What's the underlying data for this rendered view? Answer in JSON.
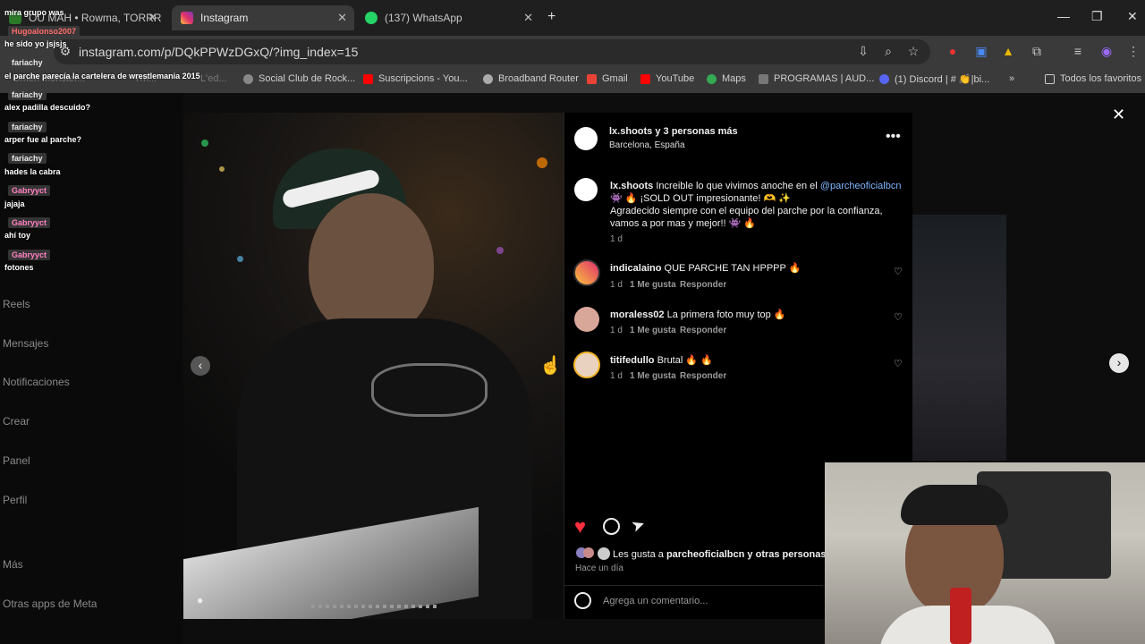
{
  "tabs": [
    {
      "label": "OU MAH • Rowma, TORRR",
      "active": false
    },
    {
      "label": "Instagram",
      "active": true
    },
    {
      "label": "(137) WhatsApp",
      "active": false
    }
  ],
  "address_bar": {
    "url": "instagram.com/p/DQkPPWzDGxQ/?img_index=15"
  },
  "bookmarks": [
    {
      "label": "Social Club de Rock...",
      "color": "#888"
    },
    {
      "label": "Suscripcions - You...",
      "color": "#ff0000"
    },
    {
      "label": "Broadband Router",
      "color": "#aaa"
    },
    {
      "label": "Gmail",
      "color": "#ea4335"
    },
    {
      "label": "YouTube",
      "color": "#ff0000"
    },
    {
      "label": "Maps",
      "color": "#34a853"
    },
    {
      "label": "PROGRAMAS | AUD...",
      "color": "#777"
    },
    {
      "label": "(1) Discord | # 👏|bi...",
      "color": "#5865f2"
    }
  ],
  "bookmarks_partial": {
    "a": "Omen Monster...",
    "b": "Tm...",
    "c": "L'ed..."
  },
  "bookmarks_folder": "Todos los favoritos",
  "sidebar_nav": [
    "Reels",
    "Mensajes",
    "Notificaciones",
    "Crear",
    "Panel",
    "Perfil",
    "Más",
    "Otras apps de Meta"
  ],
  "post": {
    "header_user": "lx.shoots y 3 personas más",
    "location": "Barcelona, España",
    "caption_user": "lx.shoots",
    "caption_line1": "Increible lo que vivimos anoche en el",
    "caption_mention": "@parcheoficialbcn",
    "caption_line2": "👾 🔥 ¡SOLD OUT impresionante! 🫶 ✨",
    "caption_line3": "Agradecido siempre con el equipo del parche por la confianza,",
    "caption_line4": "vamos a por mas y mejor!! 👾 🔥",
    "caption_time": "1 d",
    "comments": [
      {
        "user": "indicalaino",
        "text": "QUE PARCHE TAN HPPPP 🔥",
        "time": "1 d",
        "likes": "1 Me gusta",
        "reply": "Responder"
      },
      {
        "user": "moraless02",
        "text": "La primera foto muy top 🔥",
        "time": "1 d",
        "likes": "1 Me gusta",
        "reply": "Responder"
      },
      {
        "user": "titifedullo",
        "text": "Brutal 🔥 🔥",
        "time": "1 d",
        "likes": "1 Me gusta",
        "reply": "Responder"
      }
    ],
    "likes_prefix": "Les gusta a",
    "likes_user": "parcheoficialbcn",
    "likes_suffix": "y otras personas",
    "posted": "Hace un día",
    "comment_placeholder": "Agrega un comentario..."
  },
  "chat": [
    {
      "type": "msg",
      "text": "mira grupo was"
    },
    {
      "type": "name",
      "text": "Hugoalonso2007",
      "color": "#ff6b6b"
    },
    {
      "type": "msg",
      "text": "he sido yo jsjsjs"
    },
    {
      "type": "name",
      "text": "fariachy",
      "color": "#e8e8e8"
    },
    {
      "type": "msg",
      "text": "el parche parecía la cartelera de wrestlemania 2015"
    },
    {
      "type": "name",
      "text": "fariachy",
      "color": "#e8e8e8"
    },
    {
      "type": "msg",
      "text": "alex padilla descuido?"
    },
    {
      "type": "name",
      "text": "fariachy",
      "color": "#e8e8e8"
    },
    {
      "type": "msg",
      "text": "arper fue al parche?"
    },
    {
      "type": "name",
      "text": "fariachy",
      "color": "#e8e8e8"
    },
    {
      "type": "msg",
      "text": "hades la cabra"
    },
    {
      "type": "name",
      "text": "Gabryyct",
      "color": "#ff80c0"
    },
    {
      "type": "msg",
      "text": "jajaja"
    },
    {
      "type": "name",
      "text": "Gabryyct",
      "color": "#ff80c0"
    },
    {
      "type": "msg",
      "text": "ahí toy"
    },
    {
      "type": "name",
      "text": "Gabryyct",
      "color": "#ff80c0"
    },
    {
      "type": "msg",
      "text": "fotones"
    }
  ],
  "colors": {
    "accent_blue": "#e0f1ff",
    "like_red": "#ff3040",
    "mention_blue": "#7fb6ff"
  },
  "icons": [
    "close-icon",
    "more-icon",
    "heart-icon",
    "comment-icon",
    "share-icon",
    "emoji-icon",
    "arrow-left-icon",
    "arrow-right-icon",
    "star-icon",
    "extension-icon"
  ]
}
